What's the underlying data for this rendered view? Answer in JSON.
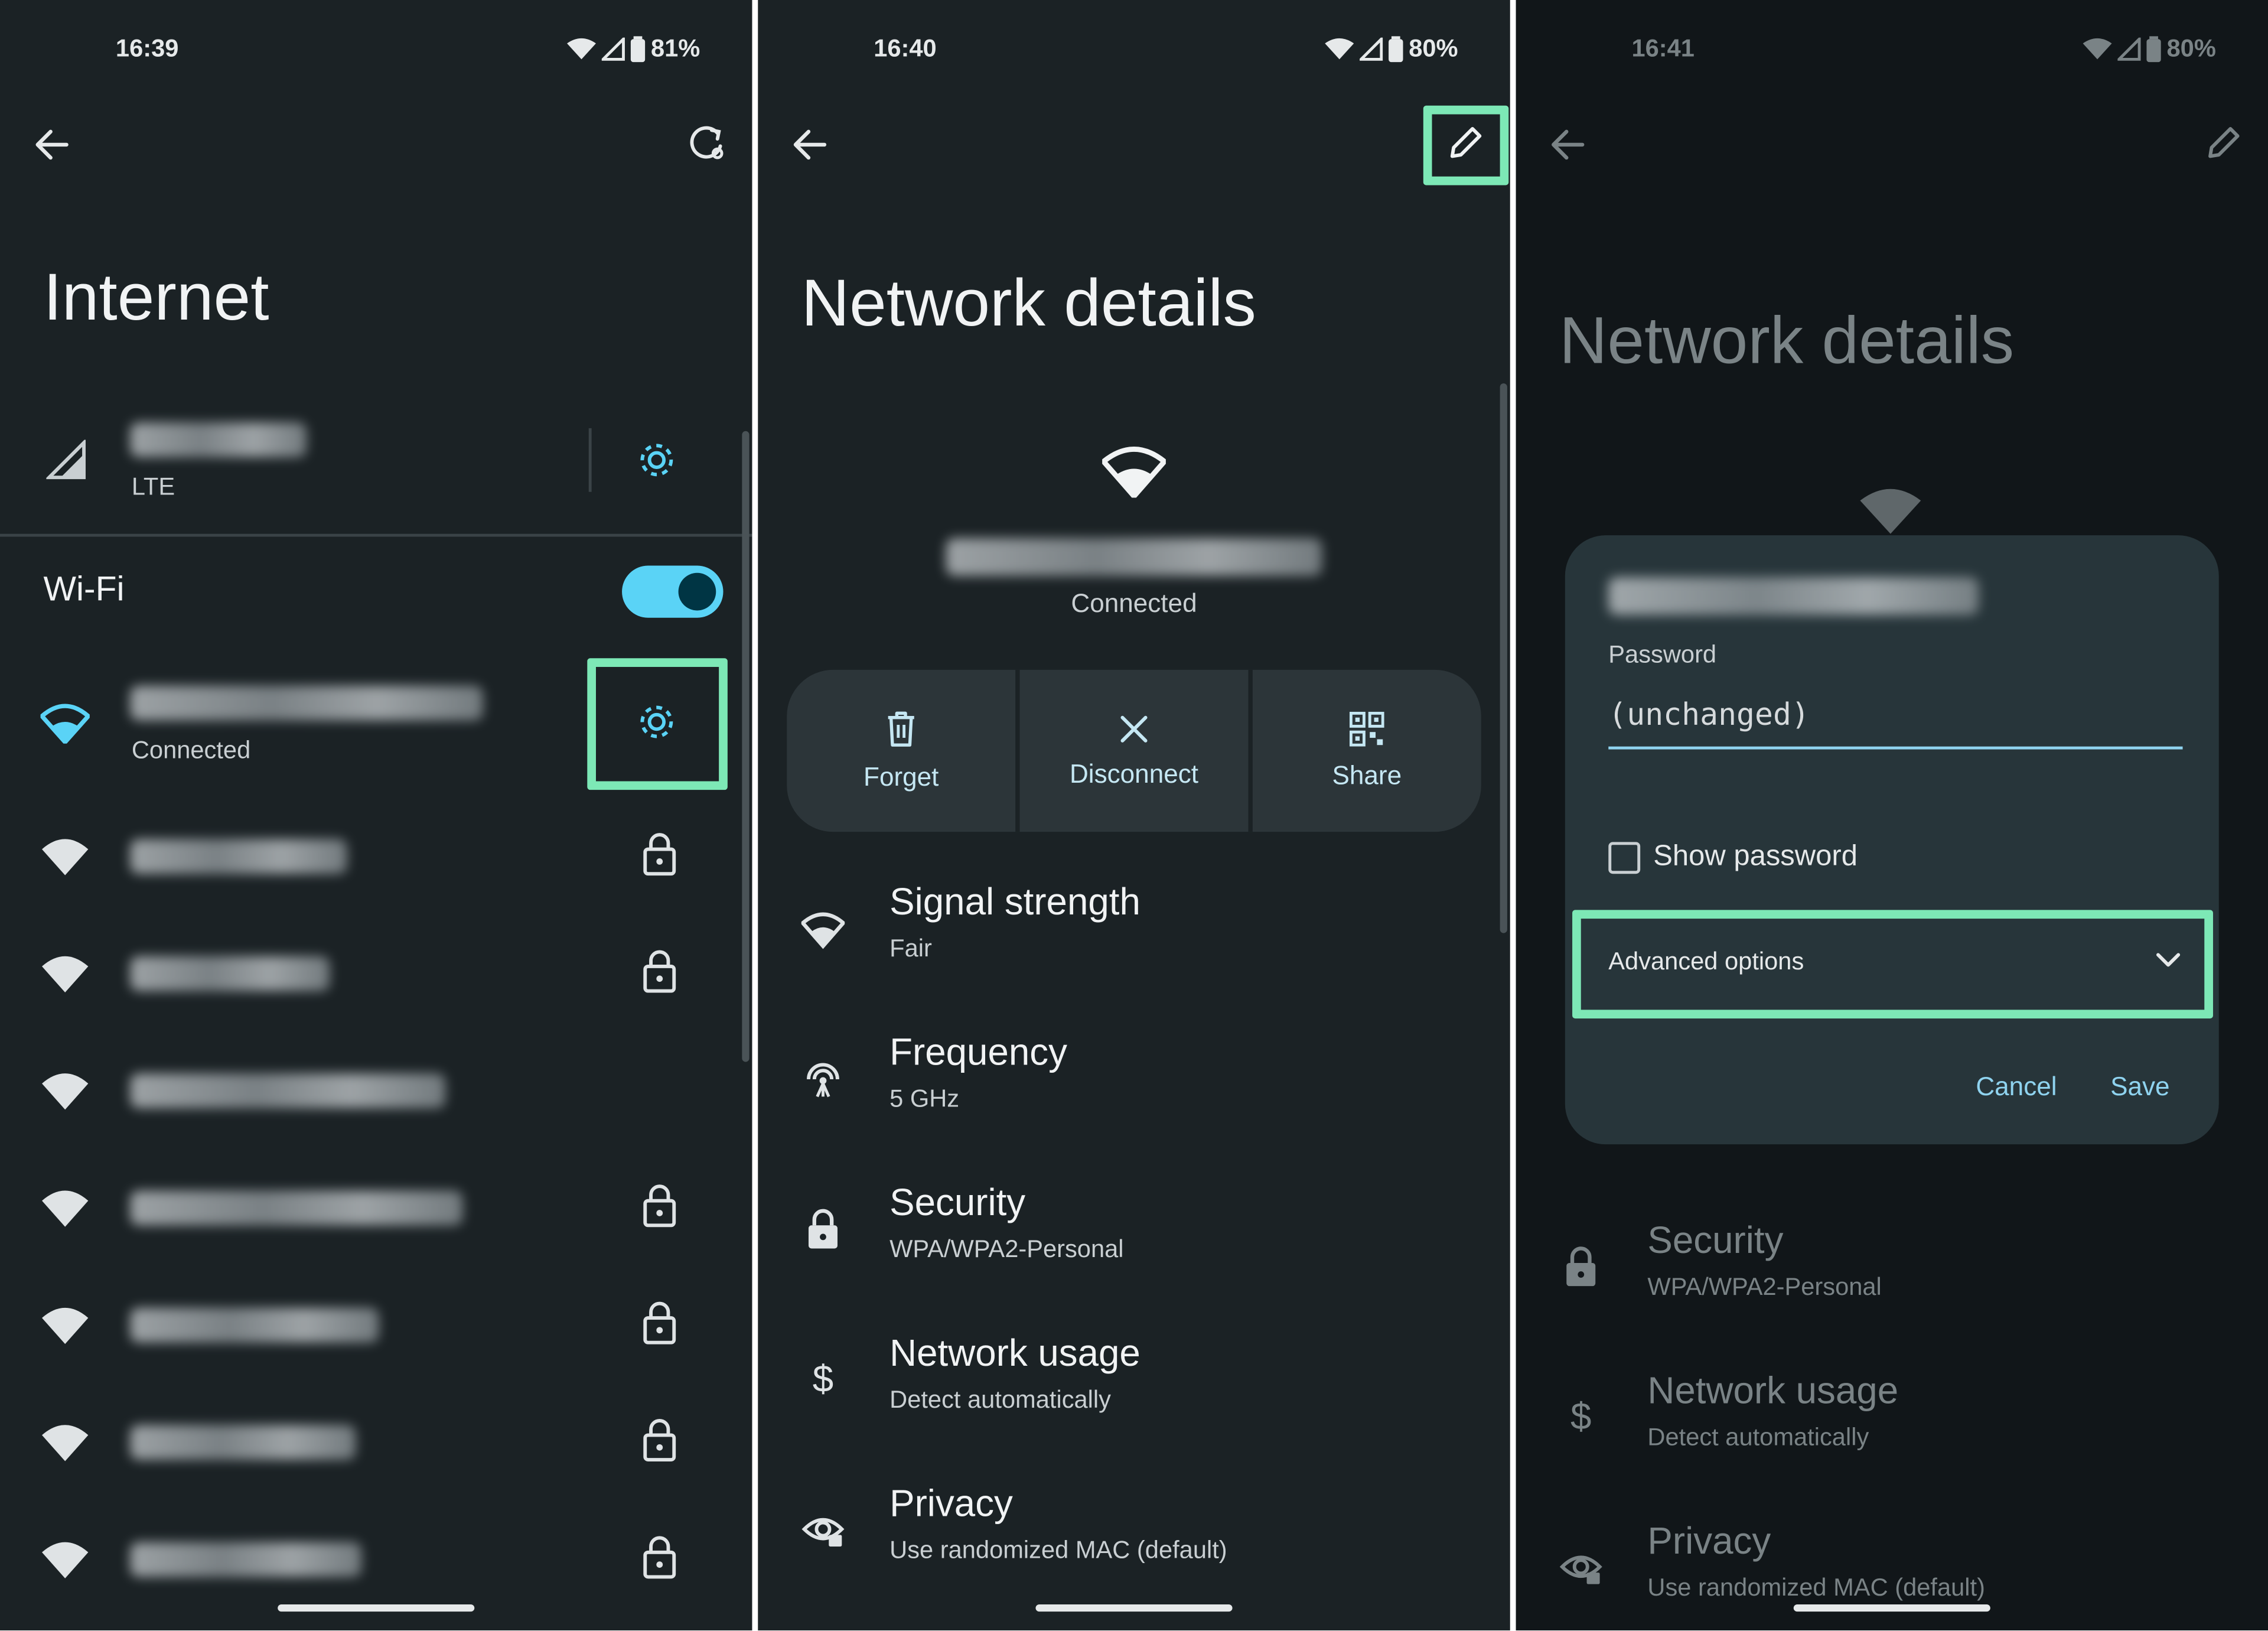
{
  "panel1": {
    "status": {
      "time": "16:39",
      "battery": "81%"
    },
    "title": "Internet",
    "mobile": {
      "type": "LTE"
    },
    "wifi_label": "Wi-Fi",
    "wifi_toggle_on": true,
    "networks": [
      {
        "status": "Connected",
        "secured": false,
        "connected": true
      },
      {
        "status": "",
        "secured": true
      },
      {
        "status": "",
        "secured": true
      },
      {
        "status": "",
        "secured": false
      },
      {
        "status": "",
        "secured": true
      },
      {
        "status": "",
        "secured": true
      },
      {
        "status": "",
        "secured": true
      },
      {
        "status": "",
        "secured": true
      }
    ]
  },
  "panel2": {
    "status": {
      "time": "16:40",
      "battery": "80%"
    },
    "title": "Network details",
    "connection_status": "Connected",
    "actions": {
      "forget": "Forget",
      "disconnect": "Disconnect",
      "share": "Share"
    },
    "details": [
      {
        "heading": "Signal strength",
        "value": "Fair"
      },
      {
        "heading": "Frequency",
        "value": "5 GHz"
      },
      {
        "heading": "Security",
        "value": "WPA/WPA2-Personal"
      },
      {
        "heading": "Network usage",
        "value": "Detect automatically"
      },
      {
        "heading": "Privacy",
        "value": "Use randomized MAC (default)"
      }
    ]
  },
  "panel3": {
    "status": {
      "time": "16:41",
      "battery": "80%"
    },
    "title": "Network details",
    "background_details": [
      {
        "heading": "Security",
        "value": "WPA/WPA2-Personal"
      },
      {
        "heading": "Network usage",
        "value": "Detect automatically"
      },
      {
        "heading": "Privacy",
        "value": "Use randomized MAC (default)"
      }
    ],
    "dialog": {
      "password_label": "Password",
      "password_value": "(unchanged)",
      "show_password": "Show password",
      "advanced_options": "Advanced options",
      "cancel": "Cancel",
      "save": "Save"
    }
  },
  "colors": {
    "highlight": "#7de8b6",
    "accent": "#5ad3f6",
    "link": "#8fd3ef",
    "background": "#1b2225"
  }
}
